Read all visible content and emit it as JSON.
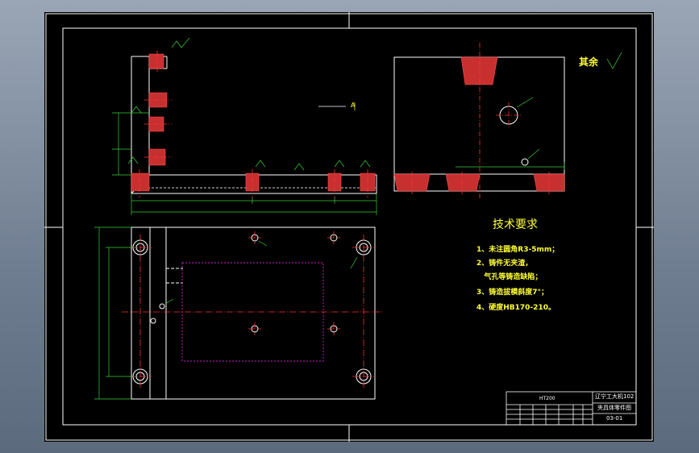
{
  "drawing": {
    "surface_finish_other": "其余",
    "tech_title": "技术要求",
    "tech_items": [
      "1、未注圆角R3-5mm；",
      "2、铸件无夹渣，",
      "   气孔等铸造缺陷；",
      "3、铸造拔模斜度7°；",
      "4、硬度HB170-210。"
    ],
    "section_mark": "A",
    "title_block": {
      "material": "HT200",
      "school": "辽宁工大机102",
      "part_name": "夹具体零件图",
      "drawing_no": "03-01"
    }
  },
  "colors": {
    "sheet": "#000000",
    "outline": "#ffffff",
    "dimension": "#35d035",
    "centerline": "#ff3030",
    "hatch": "#ff3030",
    "text": "#ffff33",
    "hidden": "#d020d0",
    "title_text": "#ffffff"
  }
}
